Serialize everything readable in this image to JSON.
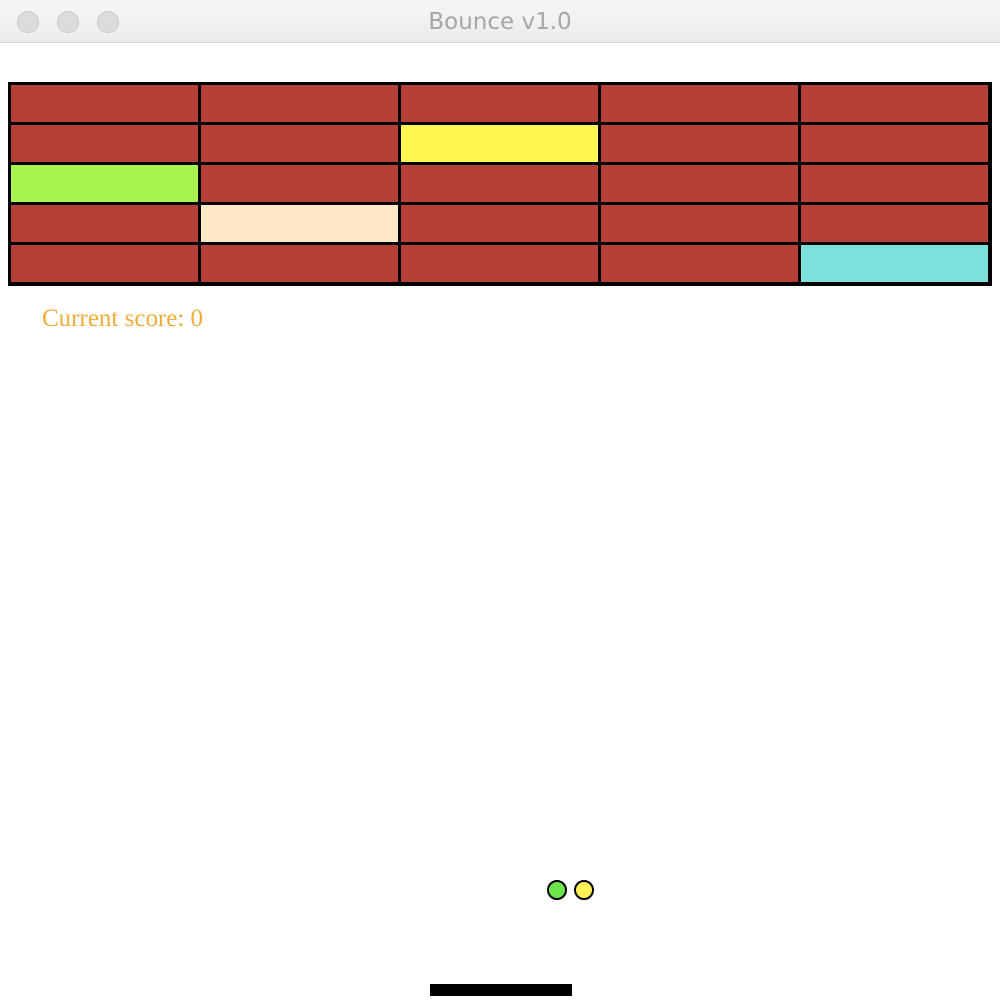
{
  "window": {
    "title": "Bounce v1.0"
  },
  "bricks": [
    [
      "#b44038",
      "#b44038",
      "#b44038",
      "#b44038",
      "#b44038"
    ],
    [
      "#b44038",
      "#b44038",
      "#fff853",
      "#b44038",
      "#b44038"
    ],
    [
      "#a6f54e",
      "#b44038",
      "#b44038",
      "#b44038",
      "#b44038"
    ],
    [
      "#b44038",
      "#fde8ca",
      "#b44038",
      "#b44038",
      "#b44038"
    ],
    [
      "#b44038",
      "#b44038",
      "#b44038",
      "#b44038",
      "#7be2db"
    ]
  ],
  "score": {
    "text": "Current score: 0",
    "value": 0,
    "color": "#efad3a"
  },
  "balls": [
    {
      "color": "#6de64b"
    },
    {
      "color": "#fff157"
    }
  ],
  "paddle": {
    "color": "#000000"
  }
}
